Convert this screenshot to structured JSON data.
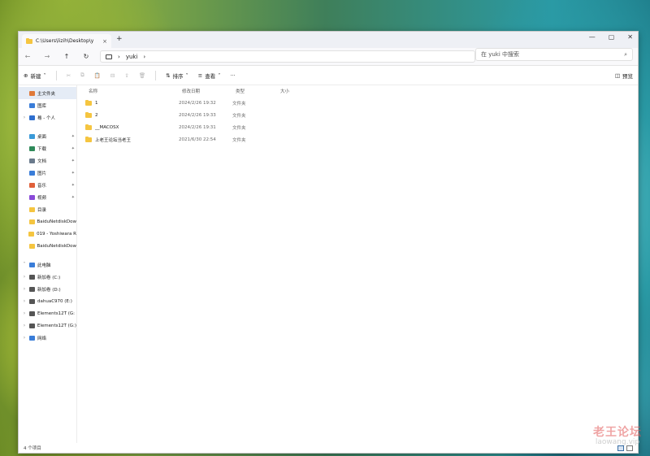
{
  "window": {
    "tab_title": "C:\\Users\\lizih\\Desktop\\y",
    "tab_close": "×",
    "new_tab": "+",
    "controls": {
      "minimize": "—",
      "maximize": "▢",
      "close": "✕"
    }
  },
  "address": {
    "back": "←",
    "forward": "→",
    "up": "↑",
    "refresh": "↻",
    "separator": "›",
    "crumb": "yuki",
    "trailing_chevron": "›",
    "search_placeholder": "在 yuki 中搜索",
    "search_icon": "⌕"
  },
  "toolbar": {
    "new_label": "新建",
    "new_icon": "⊕",
    "cut_icon": "✂",
    "copy_icon": "⧉",
    "paste_icon": "📋",
    "rename_icon": "⊟",
    "share_icon": "⇪",
    "delete_icon": "🗑",
    "sort_label": "排序",
    "sort_icon": "⇅",
    "view_label": "查看",
    "view_icon": "≡",
    "more_label": "···",
    "preview_label": "预览",
    "preview_icon": "◫",
    "caret": "˅"
  },
  "sidebar": {
    "items": [
      {
        "label": "主文件夹",
        "icon": "home-icon",
        "color": "#e07a3a",
        "selected": true
      },
      {
        "label": "图库",
        "icon": "gallery-icon",
        "color": "#3a7dd8"
      },
      {
        "label": "蓦 - 个人",
        "icon": "onedrive-icon",
        "color": "#2f6fcf",
        "chevron": "›"
      }
    ],
    "quick": [
      {
        "label": "桌面",
        "icon": "desktop-icon",
        "color": "#3a9ad8",
        "pin": "✦"
      },
      {
        "label": "下载",
        "icon": "download-icon",
        "color": "#2f8a5a",
        "pin": "✦"
      },
      {
        "label": "文档",
        "icon": "documents-icon",
        "color": "#6a7a8c",
        "pin": "✦"
      },
      {
        "label": "图片",
        "icon": "pictures-icon",
        "color": "#3a7dd8",
        "pin": "✦"
      },
      {
        "label": "音乐",
        "icon": "music-icon",
        "color": "#e0603a",
        "pin": "✦"
      },
      {
        "label": "视频",
        "icon": "videos-icon",
        "color": "#8a4ad8",
        "pin": "✦"
      },
      {
        "label": "目录",
        "icon": "folder-icon",
        "color": "#f5c540"
      },
      {
        "label": "BaiduNetdiskDow",
        "icon": "folder-icon",
        "color": "#f5c540"
      },
      {
        "label": "019 - Yoshiwara R",
        "icon": "folder-icon",
        "color": "#f5c540"
      },
      {
        "label": "BaiduNetdiskDow",
        "icon": "folder-icon",
        "color": "#f5c540"
      }
    ],
    "pc": [
      {
        "label": "此电脑",
        "icon": "this-pc-icon",
        "color": "#3a7dd8",
        "chevron": "˅"
      },
      {
        "label": "新加卷 (C:)",
        "icon": "drive-icon",
        "color": "#555555",
        "chevron": "›"
      },
      {
        "label": "新加卷 (D:)",
        "icon": "drive-icon",
        "color": "#555555",
        "chevron": "›"
      },
      {
        "label": "dahuaC970 (E:)",
        "icon": "drive-icon",
        "color": "#555555",
        "chevron": "›"
      },
      {
        "label": "Elements12T (G:",
        "icon": "drive-icon",
        "color": "#555555",
        "chevron": "›"
      },
      {
        "label": "Elements12T (G:)",
        "icon": "drive-icon",
        "color": "#555555",
        "chevron": "›"
      },
      {
        "label": "网络",
        "icon": "network-icon",
        "color": "#3a7dd8",
        "chevron": "›"
      }
    ]
  },
  "columns": {
    "name": "名称",
    "date": "修改日期",
    "type": "类型",
    "size": "大小"
  },
  "files": [
    {
      "name": "1",
      "date": "2024/2/26 19:32",
      "type": "文件夹"
    },
    {
      "name": "2",
      "date": "2024/2/26 19:33",
      "type": "文件夹"
    },
    {
      "name": "__MACOSX",
      "date": "2024/2/26 19:31",
      "type": "文件夹"
    },
    {
      "name": "上老王论坛当老王",
      "date": "2021/6/30 22:54",
      "type": "文件夹"
    }
  ],
  "status": {
    "count": "4 个项目"
  },
  "watermark": {
    "main": "老王论坛",
    "sub": "laowang.vip"
  }
}
